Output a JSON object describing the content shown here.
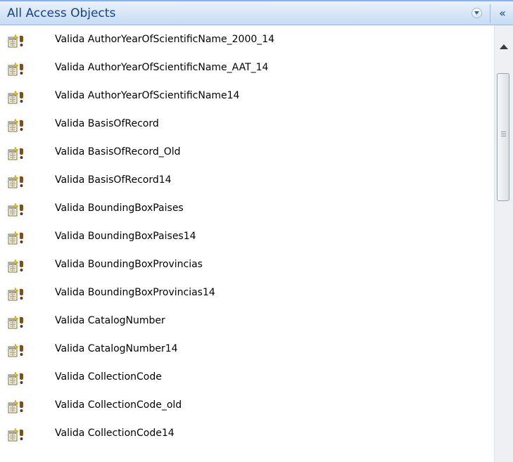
{
  "header": {
    "title": "All Access Objects",
    "dropdown_icon": "chevron-down-circle-icon",
    "collapse_glyph": "«",
    "colors": {
      "title": "#15428b",
      "bg_top": "#eaf2fc",
      "bg_bottom": "#c6dbf2"
    }
  },
  "items": [
    {
      "label": "Valida AuthorYearOfScientificName_2000_14",
      "icon": "update-query-icon"
    },
    {
      "label": "Valida AuthorYearOfScientificName_AAT_14",
      "icon": "update-query-icon"
    },
    {
      "label": "Valida AuthorYearOfScientificName14",
      "icon": "update-query-icon"
    },
    {
      "label": "Valida BasisOfRecord",
      "icon": "update-query-icon"
    },
    {
      "label": "Valida BasisOfRecord_Old",
      "icon": "update-query-icon"
    },
    {
      "label": "Valida BasisOfRecord14",
      "icon": "update-query-icon"
    },
    {
      "label": "Valida BoundingBoxPaises",
      "icon": "update-query-icon"
    },
    {
      "label": "Valida BoundingBoxPaises14",
      "icon": "update-query-icon"
    },
    {
      "label": "Valida BoundingBoxProvincias",
      "icon": "update-query-icon"
    },
    {
      "label": "Valida BoundingBoxProvincias14",
      "icon": "update-query-icon"
    },
    {
      "label": "Valida CatalogNumber",
      "icon": "update-query-icon"
    },
    {
      "label": "Valida CatalogNumber14",
      "icon": "update-query-icon"
    },
    {
      "label": "Valida CollectionCode",
      "icon": "update-query-icon"
    },
    {
      "label": "Valida CollectionCode_old",
      "icon": "update-query-icon"
    },
    {
      "label": "Valida CollectionCode14",
      "icon": "update-query-icon"
    }
  ]
}
